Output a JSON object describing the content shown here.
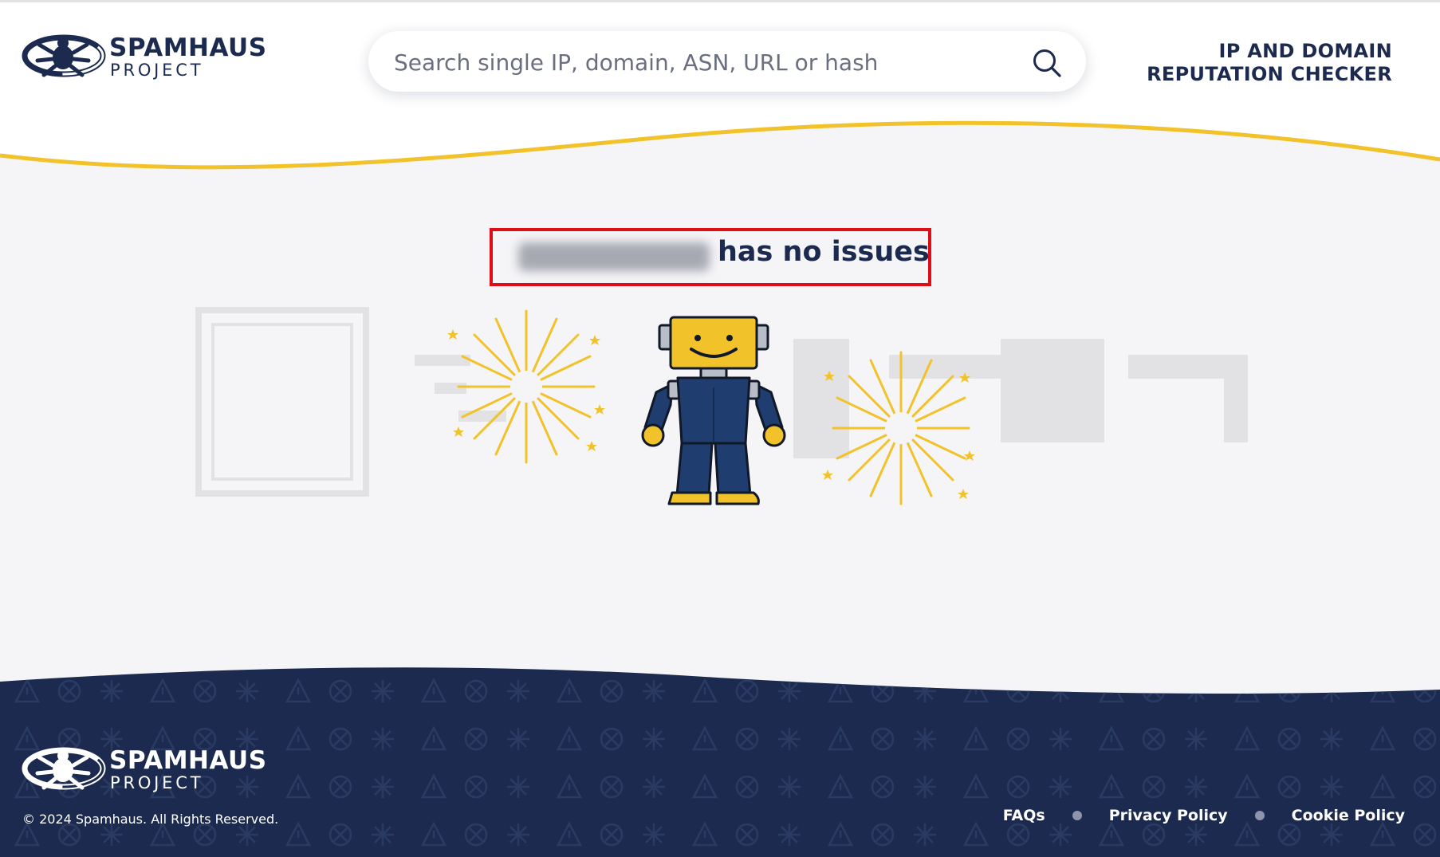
{
  "header": {
    "logo": {
      "name": "SPAMHAUS",
      "sub": "PROJECT"
    },
    "search": {
      "placeholder": "Search single IP, domain, ASN, URL or hash"
    },
    "checker_title_line1": "IP AND DOMAIN",
    "checker_title_line2": "REPUTATION CHECKER"
  },
  "result": {
    "message": "has no issues"
  },
  "footer": {
    "logo": {
      "name": "SPAMHAUS",
      "sub": "PROJECT"
    },
    "copyright": "© 2024 Spamhaus. All Rights Reserved.",
    "links": [
      "FAQs",
      "Privacy Policy",
      "Cookie Policy"
    ]
  },
  "colors": {
    "navy": "#1b2a4e",
    "yellow": "#f2c22b",
    "highlight_red": "#e00d17",
    "footer_bg": "#1b2a4e",
    "page_bg": "#f5f5f8"
  },
  "icons": [
    "spamhaus-logo-icon",
    "search-icon",
    "robot-mascot",
    "firework-icon"
  ]
}
